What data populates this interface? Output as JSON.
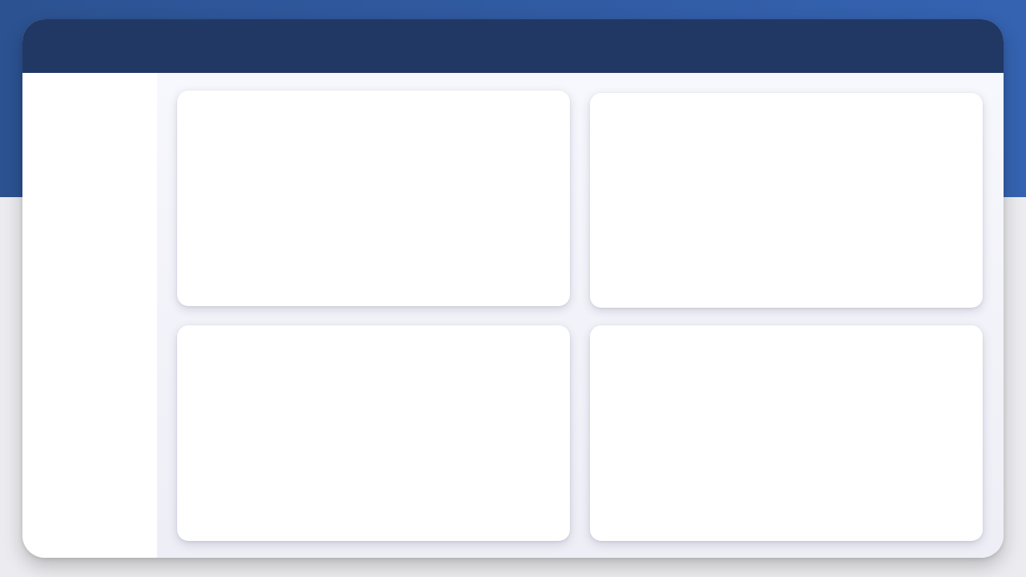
{
  "colors": {
    "banner_start": "#2c5291",
    "banner_end": "#3563b2",
    "header": "#213865",
    "sidebar": "#ffffff",
    "main_background": "#f4f5fb",
    "card": "#ffffff",
    "page_background": "#ececf0"
  },
  "main": {
    "cards": [
      {
        "title": ""
      },
      {
        "title": ""
      },
      {
        "title": ""
      },
      {
        "title": ""
      }
    ]
  }
}
